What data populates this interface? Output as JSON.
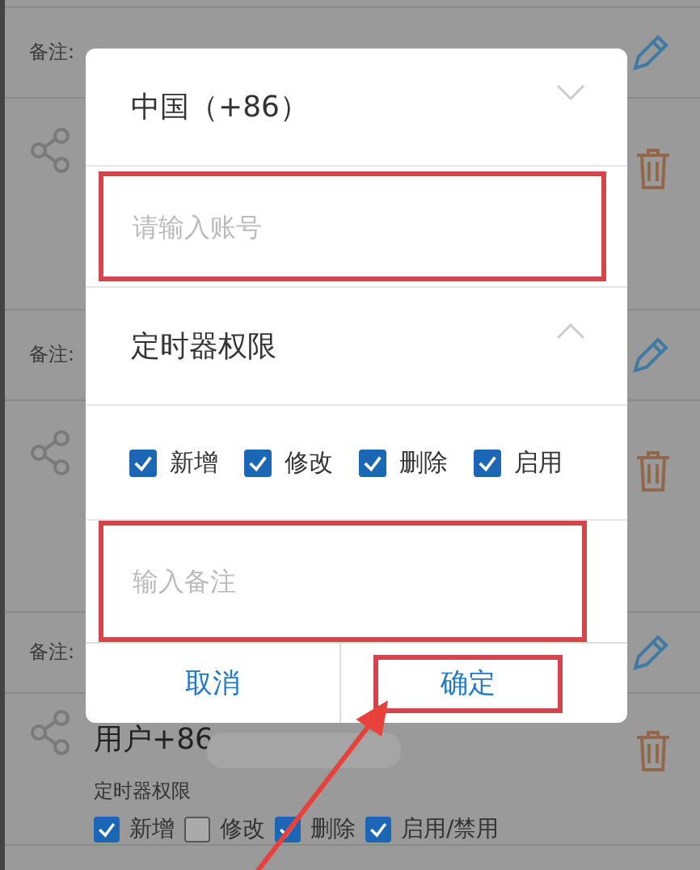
{
  "list": [
    {
      "kind": "note",
      "label": "备注:"
    },
    {
      "kind": "actions"
    },
    {
      "kind": "note",
      "label": "备注:"
    },
    {
      "kind": "actions"
    },
    {
      "kind": "note",
      "label": "备注:"
    },
    {
      "kind": "user",
      "name": "用户+86",
      "permission_title": "定时器权限",
      "permissions": [
        {
          "label": "新增",
          "checked": true
        },
        {
          "label": "修改",
          "checked": false
        },
        {
          "label": "删除",
          "checked": true
        },
        {
          "label": "启用/禁用",
          "checked": true
        }
      ]
    }
  ],
  "dialog": {
    "country": "中国（+86）",
    "account_placeholder": "请输入账号",
    "permission_title": "定时器权限",
    "expanded": true,
    "permissions": [
      {
        "label": "新增",
        "checked": true
      },
      {
        "label": "修改",
        "checked": true
      },
      {
        "label": "删除",
        "checked": true
      },
      {
        "label": "启用",
        "checked": true
      }
    ],
    "note_placeholder": "输入备注",
    "buttons": [
      {
        "label": "取消",
        "kind": "cancel"
      },
      {
        "label": "确定",
        "kind": "confirm"
      }
    ]
  }
}
